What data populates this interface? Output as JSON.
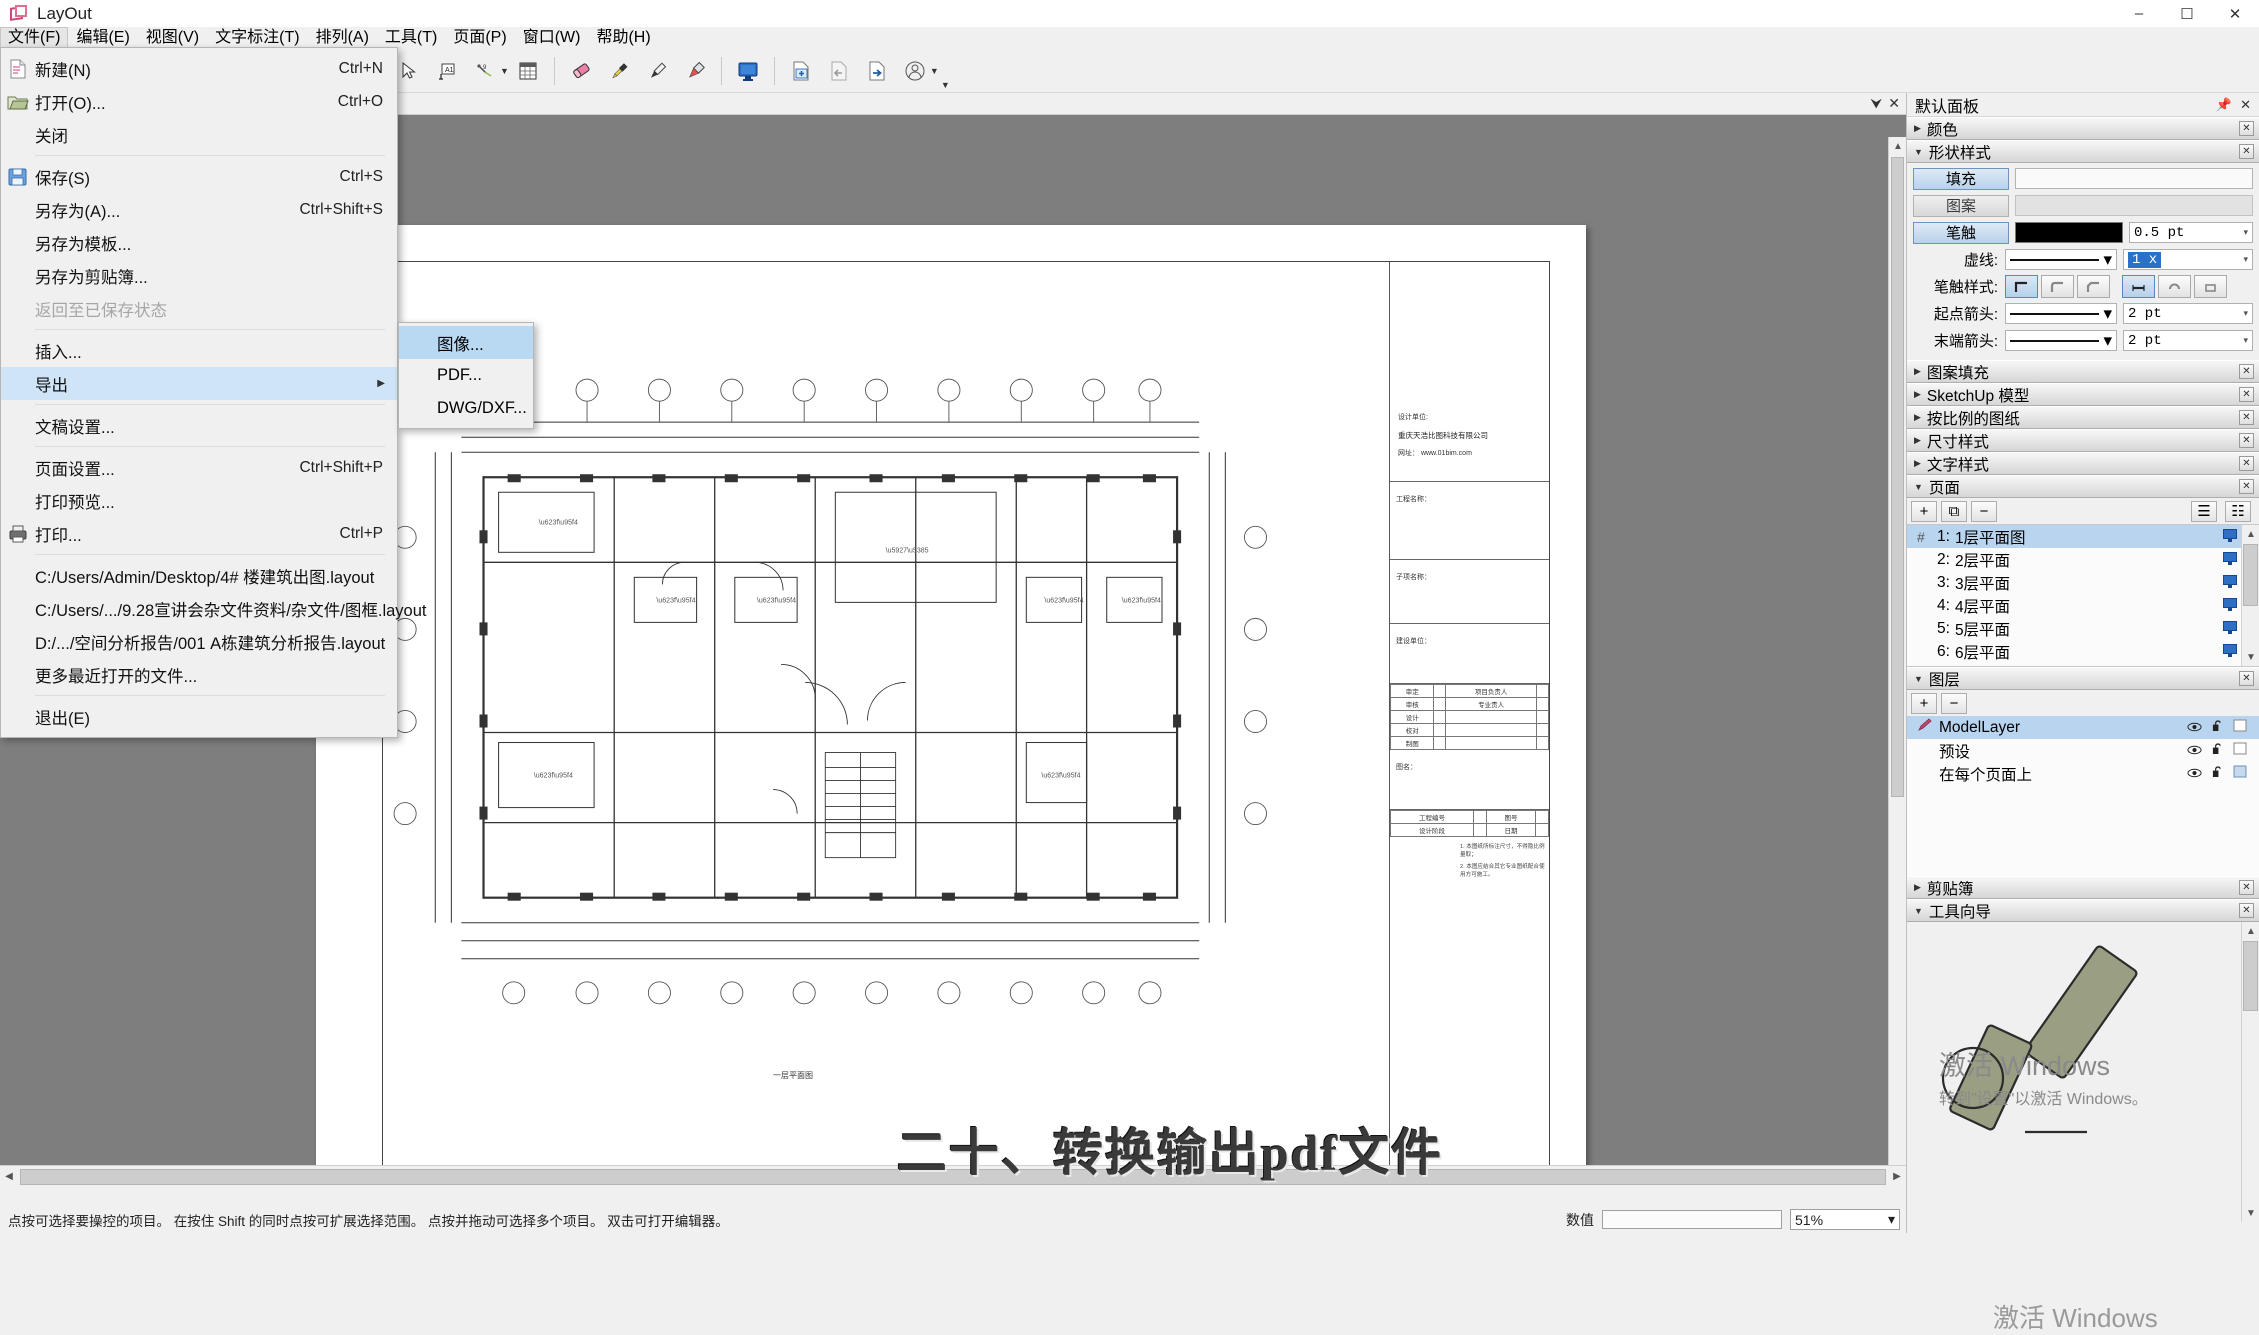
{
  "window": {
    "app_title": "LayOut",
    "minimize": "–",
    "maximize": "☐",
    "close": "✕"
  },
  "menubar": {
    "items": [
      {
        "label": "文件(F)",
        "active": true
      },
      {
        "label": "编辑(E)"
      },
      {
        "label": "视图(V)"
      },
      {
        "label": "文字标注(T)"
      },
      {
        "label": "排列(A)"
      },
      {
        "label": "工具(T)"
      },
      {
        "label": "页面(P)"
      },
      {
        "label": "窗口(W)"
      },
      {
        "label": "帮助(H)"
      }
    ]
  },
  "file_menu": {
    "items": [
      {
        "label": "新建(N)",
        "accel": "Ctrl+N",
        "icon": "new-document-icon"
      },
      {
        "label": "打开(O)...",
        "accel": "Ctrl+O",
        "icon": "open-folder-icon"
      },
      {
        "label": "关闭",
        "accel": "",
        "icon": ""
      },
      {
        "sep": true
      },
      {
        "label": "保存(S)",
        "accel": "Ctrl+S",
        "icon": "save-disk-icon"
      },
      {
        "label": "另存为(A)...",
        "accel": "Ctrl+Shift+S",
        "icon": ""
      },
      {
        "label": "另存为模板...",
        "accel": "",
        "icon": ""
      },
      {
        "label": "另存为剪贴簿...",
        "accel": "",
        "icon": ""
      },
      {
        "label": "返回至已保存状态",
        "accel": "",
        "icon": "",
        "disabled": true
      },
      {
        "sep": true
      },
      {
        "label": "插入...",
        "accel": "",
        "icon": ""
      },
      {
        "label": "导出",
        "accel": "",
        "icon": "",
        "selected": true,
        "submenu": true
      },
      {
        "sep": true
      },
      {
        "label": "文稿设置...",
        "accel": "",
        "icon": ""
      },
      {
        "sep": true
      },
      {
        "label": "页面设置...",
        "accel": "Ctrl+Shift+P",
        "icon": ""
      },
      {
        "label": "打印预览...",
        "accel": "",
        "icon": ""
      },
      {
        "label": "打印...",
        "accel": "Ctrl+P",
        "icon": "printer-icon"
      },
      {
        "sep": true
      },
      {
        "label": "C:/Users/Admin/Desktop/4# 楼建筑出图.layout",
        "accel": "",
        "icon": ""
      },
      {
        "label": "C:/Users/.../9.28宣讲会杂文件资料/杂文件/图框.layout",
        "accel": "",
        "icon": ""
      },
      {
        "label": "D:/.../空间分析报告/001 A栋建筑分析报告.layout",
        "accel": "",
        "icon": ""
      },
      {
        "label": "更多最近打开的文件...",
        "accel": "",
        "icon": ""
      },
      {
        "sep": true
      },
      {
        "label": "退出(E)",
        "accel": "",
        "icon": ""
      }
    ]
  },
  "export_submenu": {
    "items": [
      {
        "label": "图像...",
        "selected": true
      },
      {
        "label": "PDF..."
      },
      {
        "label": "DWG/DXF..."
      }
    ]
  },
  "toolbar": {
    "icons": [
      "select-arrow-icon",
      "eraser-icon",
      "text-tool-icon",
      "label-tool-icon",
      "dimension-tool-icon",
      "table-icon",
      "eraser-pink-icon",
      "eyedropper-icon",
      "pen-icon",
      "highlighter-icon",
      "display-monitor-icon",
      "add-page-icon",
      "previous-page-icon",
      "next-page-icon",
      "account-icon"
    ]
  },
  "document": {
    "titleblock": {
      "design_unit_label": "设计单位:",
      "company": "重庆天浩比图科技有限公司",
      "website": "网址： www.01bim.com",
      "project_label": "工程名称：",
      "sub_label": "子项名称：",
      "build_label": "建设单位：",
      "rows": [
        {
          "a": "审定",
          "b": "",
          "c": "项目负责人",
          "d": ""
        },
        {
          "a": "审核",
          "b": "",
          "c": "专业责人",
          "d": ""
        },
        {
          "a": "设计",
          "b": "",
          "c": "",
          "d": ""
        },
        {
          "a": "校对",
          "b": "",
          "c": "",
          "d": ""
        },
        {
          "a": "制图",
          "b": "",
          "c": "",
          "d": ""
        }
      ],
      "drawing_name_label": "图名：",
      "bottom_rows": [
        {
          "a": "工程编号",
          "b": "",
          "c": "图号",
          "d": ""
        },
        {
          "a": "设计阶段",
          "b": "",
          "c": "日期",
          "d": ""
        }
      ],
      "notes": [
        "1. 本图纸所标注尺寸，不得隐比例量取；",
        "2. 本图应结合其它专业图纸配合使用方可施工。"
      ]
    },
    "drawing_caption": "一层平面图"
  },
  "caption_overlay": "二十、转换输出pdf文件",
  "right_panel": {
    "title": "默认面板",
    "pin": "📌",
    "close": "✕",
    "sections": {
      "color": {
        "label": "颜色",
        "expanded": false
      },
      "shape_style": {
        "label": "形状样式",
        "expanded": true,
        "fill_label": "填充",
        "pattern_label": "图案",
        "stroke_label": "笔触",
        "stroke_width": "0.5 pt",
        "dash_label": "虚线:",
        "dash_scale": "1 x",
        "stroke_style_label": "笔触样式:",
        "start_arrow_label": "起点箭头:",
        "start_arrow_size": "2 pt",
        "end_arrow_label": "末端箭头:",
        "end_arrow_size": "2 pt"
      },
      "pattern_fill": {
        "label": "图案填充",
        "expanded": false
      },
      "sketchup_model": {
        "label": "SketchUp 模型",
        "expanded": false
      },
      "scaled_drawing": {
        "label": "按比例的图纸",
        "expanded": false
      },
      "dimension_style": {
        "label": "尺寸样式",
        "expanded": false
      },
      "text_style": {
        "label": "文字样式",
        "expanded": false
      },
      "pages": {
        "label": "页面",
        "expanded": true,
        "add": "+",
        "duplicate": "⧉",
        "remove": "−",
        "list_view": "☰",
        "grid_view": "☷",
        "items": [
          {
            "num": "1:",
            "name": "1层平面图",
            "selected": true
          },
          {
            "num": "2:",
            "name": "2层平面"
          },
          {
            "num": "3:",
            "name": "3层平面"
          },
          {
            "num": "4:",
            "name": "4层平面"
          },
          {
            "num": "5:",
            "name": "5层平面"
          },
          {
            "num": "6:",
            "name": "6层平面"
          }
        ]
      },
      "layers": {
        "label": "图层",
        "expanded": true,
        "add": "+",
        "remove": "−",
        "items": [
          {
            "name": "ModelLayer",
            "selected": true
          },
          {
            "name": "预设"
          },
          {
            "name": "在每个页面上"
          }
        ]
      },
      "clipboard": {
        "label": "剪贴簿",
        "expanded": false
      },
      "tool_guide": {
        "label": "工具向导",
        "expanded": true
      }
    }
  },
  "statusbar": {
    "message": "点按可选择要操控的项目。  在按住 Shift 的同时点按可扩展选择范围。  点按并拖动可选择多个项目。  双击可打开编辑器。",
    "value_label": "数值",
    "value_input": "",
    "zoom": "51%"
  },
  "watermark": {
    "line1": "激活 Windows",
    "line2": "转到\"设置\"以激活 Windows。",
    "ghost": "激活 Windows"
  },
  "colors": {
    "accent": "#2a72c8",
    "selection": "#cfe4f7",
    "panel_bg": "#f0f0f0",
    "canvas_bg": "#7e7e7e",
    "paper": "#ffffff"
  }
}
